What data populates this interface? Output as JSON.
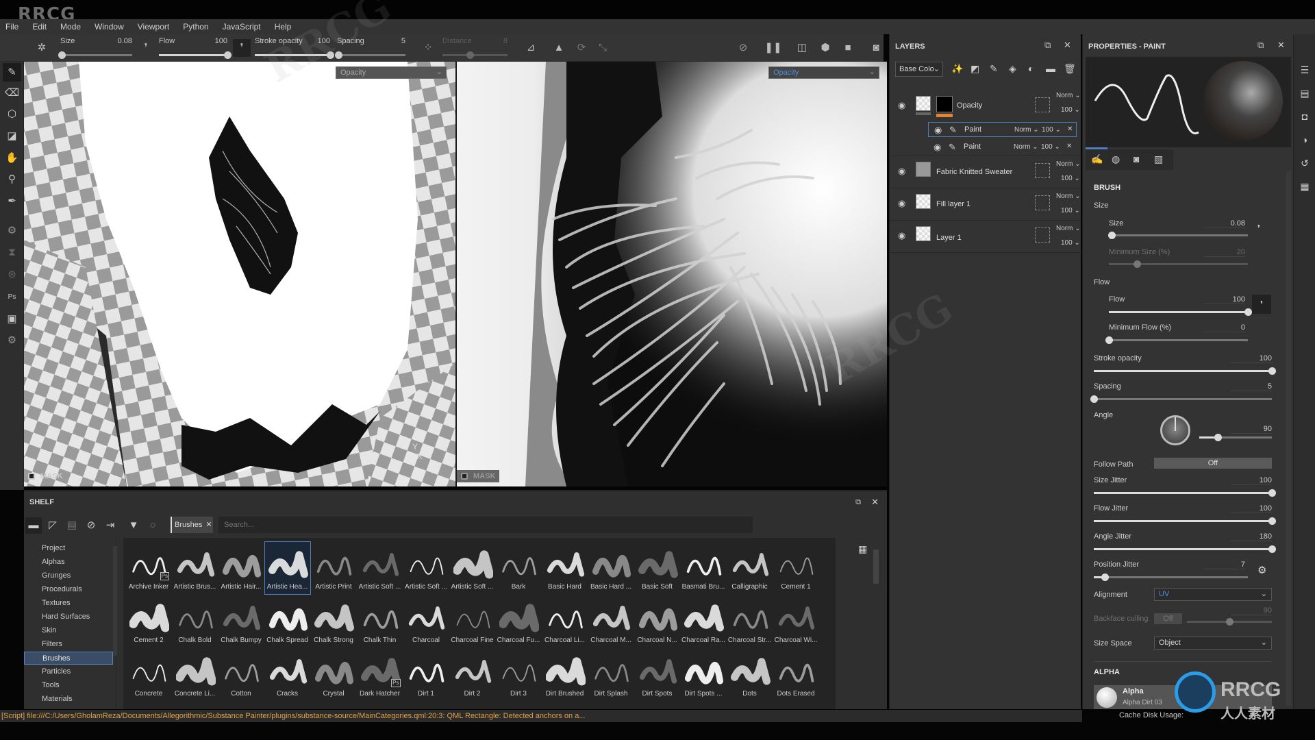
{
  "watermark": {
    "text": "RRCG",
    "cn_text": "人人素材",
    "brand": "RRCG"
  },
  "menubar": {
    "items": [
      "File",
      "Edit",
      "Mode",
      "Window",
      "Viewport",
      "Python",
      "JavaScript",
      "Help"
    ]
  },
  "toolbar": {
    "size": {
      "label": "Size",
      "value": "0.08",
      "fraction": 0.02
    },
    "flow": {
      "label": "Flow",
      "value": "100",
      "fraction": 1.0
    },
    "stroke_opacity": {
      "label": "Stroke opacity",
      "value": "100",
      "fraction": 1.0
    },
    "spacing": {
      "label": "Spacing",
      "value": "5",
      "fraction": 0.02
    },
    "distance": {
      "label": "Distance",
      "value": "8",
      "fraction": 0.42,
      "disabled": true
    },
    "icons": [
      "lazy-mouse-icon",
      "symmetry-icon",
      "symmetry-settings-icon",
      "projection-icon",
      "hide-icon",
      "pause-icon",
      "split-view-icon",
      "display-3d-icon",
      "camera-icon",
      "screenshot-icon"
    ]
  },
  "left_tools": [
    "paint-brush-icon",
    "eraser-icon",
    "projection-icon",
    "polygon-fill-icon",
    "smudge-icon",
    "clone-stamp-icon",
    "color-picker-icon",
    "bake-icon",
    "hourglass-icon",
    "sync-icon",
    "photoshop-export-icon",
    "export-icon",
    "settings-icon"
  ],
  "viewport_left": {
    "channel_select": "Opacity",
    "mask_label": "MASK"
  },
  "viewport_right": {
    "channel_select": "Opacity",
    "mask_label": "MASK"
  },
  "shelf": {
    "title": "SHELF",
    "filter_tag": "Brushes",
    "search_placeholder": "Search...",
    "categories": [
      "Project",
      "Alphas",
      "Grunges",
      "Procedurals",
      "Textures",
      "Hard Surfaces",
      "Skin",
      "Filters",
      "Brushes",
      "Particles",
      "Tools",
      "Materials"
    ],
    "active_category": "Brushes",
    "items": [
      {
        "name": "Archive Inker",
        "ps": true
      },
      {
        "name": "Artistic Brus..."
      },
      {
        "name": "Artistic Hair..."
      },
      {
        "name": "Artistic Hea...",
        "selected": true
      },
      {
        "name": "Artistic Print"
      },
      {
        "name": "Artistic Soft ..."
      },
      {
        "name": "Artistic Soft ..."
      },
      {
        "name": "Artistic Soft ..."
      },
      {
        "name": "Bark"
      },
      {
        "name": "Basic Hard"
      },
      {
        "name": "Basic Hard ..."
      },
      {
        "name": "Basic Soft"
      },
      {
        "name": "Basmati Bru..."
      },
      {
        "name": "Calligraphic"
      },
      {
        "name": "Cement 1"
      },
      {
        "name": "Cement 2"
      },
      {
        "name": "Chalk Bold"
      },
      {
        "name": "Chalk Bumpy"
      },
      {
        "name": "Chalk Spread"
      },
      {
        "name": "Chalk Strong"
      },
      {
        "name": "Chalk Thin"
      },
      {
        "name": "Charcoal"
      },
      {
        "name": "Charcoal Fine"
      },
      {
        "name": "Charcoal Fu..."
      },
      {
        "name": "Charcoal Li..."
      },
      {
        "name": "Charcoal M..."
      },
      {
        "name": "Charcoal N..."
      },
      {
        "name": "Charcoal Ra..."
      },
      {
        "name": "Charcoal Str..."
      },
      {
        "name": "Charcoal Wi..."
      },
      {
        "name": "Concrete"
      },
      {
        "name": "Concrete Li..."
      },
      {
        "name": "Cotton"
      },
      {
        "name": "Cracks"
      },
      {
        "name": "Crystal"
      },
      {
        "name": "Dark Hatcher",
        "ps": true
      },
      {
        "name": "Dirt 1"
      },
      {
        "name": "Dirt 2"
      },
      {
        "name": "Dirt 3"
      },
      {
        "name": "Dirt Brushed"
      },
      {
        "name": "Dirt Splash"
      },
      {
        "name": "Dirt Spots"
      },
      {
        "name": "Dirt Spots ..."
      },
      {
        "name": "Dots"
      },
      {
        "name": "Dots Erased"
      }
    ]
  },
  "status": {
    "message": "[Script] file:///C:/Users/GholamReza/Documents/Allegorithmic/Substance Painter/plugins/substance-source/MainCategories.qml:20:3: QML Rectangle: Detected anchors on a...",
    "cache_label": "Cache Disk Usage:"
  },
  "layers": {
    "title": "LAYERS",
    "channel": "Base Colo",
    "rows": [
      {
        "name": "Opacity",
        "blend": "Norm",
        "opacity": "100",
        "type": "group"
      },
      {
        "name": "Paint",
        "blend": "Norm",
        "opacity": "100",
        "type": "paint",
        "selected": true
      },
      {
        "name": "Paint",
        "blend": "Norm",
        "opacity": "100",
        "type": "paint"
      },
      {
        "name": "Fabric Knitted Sweater",
        "blend": "Norm",
        "opacity": "100",
        "type": "fill"
      },
      {
        "name": "Fill layer 1",
        "blend": "Norm",
        "opacity": "100",
        "type": "fill"
      },
      {
        "name": "Layer 1",
        "blend": "Norm",
        "opacity": "100",
        "type": "layer"
      }
    ]
  },
  "properties": {
    "title": "PROPERTIES - PAINT",
    "brush_section": "BRUSH",
    "size_group": "Size",
    "size": {
      "label": "Size",
      "value": "0.08",
      "fraction": 0.02
    },
    "min_size": {
      "label": "Minimum Size (%)",
      "value": "20",
      "fraction": 0.2,
      "disabled": true
    },
    "flow_group": "Flow",
    "flow": {
      "label": "Flow",
      "value": "100",
      "fraction": 1.0
    },
    "min_flow": {
      "label": "Minimum Flow (%)",
      "value": "0",
      "fraction": 0.0
    },
    "stroke_opacity": {
      "label": "Stroke opacity",
      "value": "100",
      "fraction": 1.0
    },
    "spacing": {
      "label": "Spacing",
      "value": "5",
      "fraction": 0.0
    },
    "angle": {
      "label": "Angle",
      "value": "90",
      "fraction": 0.25
    },
    "follow_path": {
      "label": "Follow Path",
      "value": "Off"
    },
    "size_jitter": {
      "label": "Size Jitter",
      "value": "100",
      "fraction": 1.0
    },
    "flow_jitter": {
      "label": "Flow Jitter",
      "value": "100",
      "fraction": 1.0
    },
    "angle_jitter": {
      "label": "Angle Jitter",
      "value": "180",
      "fraction": 1.0
    },
    "position_jitter": {
      "label": "Position Jitter",
      "value": "7",
      "fraction": 0.07
    },
    "alignment": {
      "label": "Alignment",
      "value": "UV"
    },
    "backface_culling": {
      "label": "Backface culling",
      "toggle": "Off",
      "value": "90",
      "fraction": 0.5,
      "disabled": true
    },
    "size_space": {
      "label": "Size Space",
      "value": "Object"
    },
    "alpha_section": "ALPHA",
    "alpha": {
      "title": "Alpha",
      "name": "Alpha Dirt 03"
    },
    "tabs": [
      "brush-tab",
      "alpha-tab",
      "stencil-tab",
      "material-tab"
    ]
  },
  "right_strip": [
    "texture-set-list-icon",
    "texture-set-settings-icon",
    "display-settings-icon",
    "shader-settings-icon",
    "history-icon",
    "log-icon"
  ],
  "colors": {
    "accent": "#4f7fbf",
    "status_text": "#e0a04a",
    "layer_mask_bar": "#e0843a"
  }
}
